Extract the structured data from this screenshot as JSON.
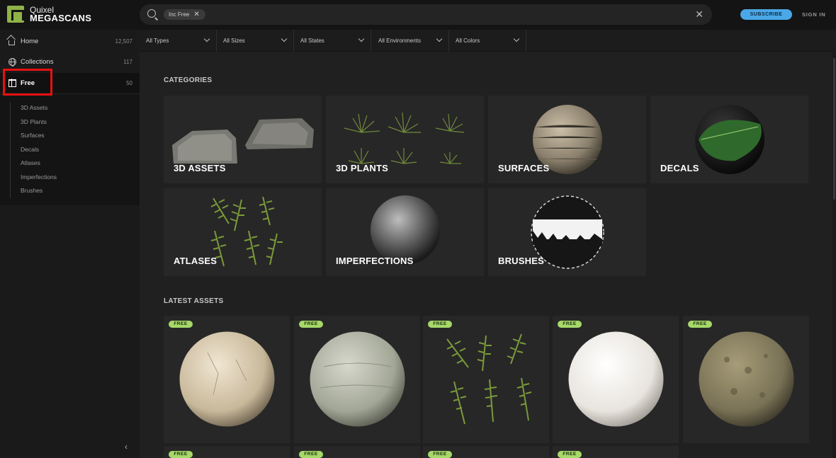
{
  "app": {
    "logo_line1": "Quixel",
    "logo_line2": "MEGASCANS"
  },
  "search": {
    "chip_label": "Inc Free",
    "chip_remove": "✕",
    "clear": "✕"
  },
  "header": {
    "subscribe_label": "SUBSCRIBE",
    "signin_label": "SIGN IN"
  },
  "sidebar": {
    "items": [
      {
        "label": "Home",
        "count": "12,507"
      },
      {
        "label": "Collections",
        "count": "117"
      },
      {
        "label": "Free",
        "count": "50"
      }
    ],
    "sub_items": [
      "3D Assets",
      "3D Plants",
      "Surfaces",
      "Decals",
      "Atlases",
      "Imperfections",
      "Brushes"
    ],
    "collapse": "‹"
  },
  "filters": [
    "All Types",
    "All Sizes",
    "All States",
    "All Environments",
    "All Colors"
  ],
  "main": {
    "categories_title": "CATEGORIES",
    "latest_title": "LATEST ASSETS",
    "categories": [
      "3D ASSETS",
      "3D PLANTS",
      "SURFACES",
      "DECALS",
      "ATLASES",
      "IMPERFECTIONS",
      "BRUSHES"
    ],
    "badge_label": "FREE"
  },
  "colors": {
    "accent_green": "#a6d86a",
    "subscribe_blue": "#4aa8e8",
    "highlight_red": "#e81010",
    "logo_green": "#8fb34a"
  }
}
